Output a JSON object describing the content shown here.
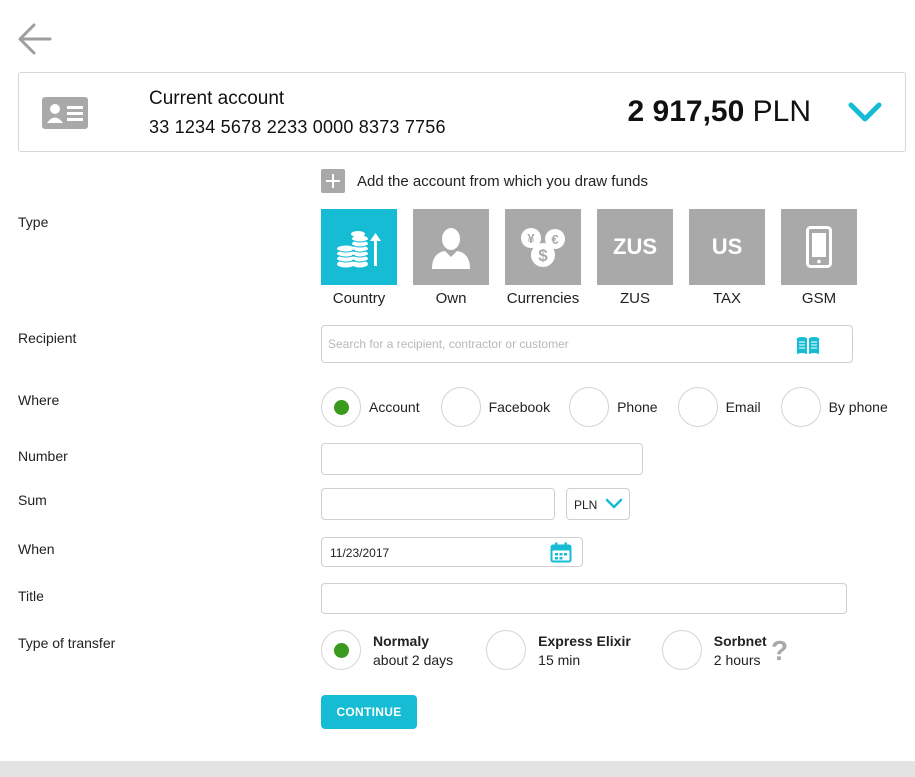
{
  "account": {
    "name": "Current account",
    "number": "33 1234 5678 2233 0000 8373 7756",
    "balance_amount": "2 917,50",
    "balance_currency": "PLN"
  },
  "add_account_label": "Add the account from which you draw funds",
  "labels": {
    "type": "Type",
    "recipient": "Recipient",
    "where": "Where",
    "number": "Number",
    "sum": "Sum",
    "when": "When",
    "title": "Title",
    "type_of_transfer": "Type of transfer"
  },
  "types": [
    {
      "label": "Country",
      "icon": "coins-growth-icon",
      "active": true
    },
    {
      "label": "Own",
      "icon": "person-icon",
      "active": false
    },
    {
      "label": "Currencies",
      "icon": "currency-exchange-icon",
      "active": false
    },
    {
      "label": "ZUS",
      "icon_text": "ZUS",
      "active": false
    },
    {
      "label": "TAX",
      "icon_text": "US",
      "active": false
    },
    {
      "label": "GSM",
      "icon": "mobile-phone-icon",
      "active": false
    }
  ],
  "recipient": {
    "placeholder": "Search for a recipient, contractor or customer",
    "value": ""
  },
  "where_options": [
    {
      "label": "Account",
      "checked": true
    },
    {
      "label": "Facebook",
      "checked": false
    },
    {
      "label": "Phone",
      "checked": false
    },
    {
      "label": "Email",
      "checked": false
    },
    {
      "label": "By phone",
      "checked": false
    }
  ],
  "number_value": "",
  "sum_value": "",
  "currency": "PLN",
  "date": "11/23/2017",
  "title_value": "",
  "transfer_types": [
    {
      "name": "Normaly",
      "desc": "about 2 days",
      "checked": true
    },
    {
      "name": "Express Elixir",
      "desc": "15 min",
      "checked": false
    },
    {
      "name": "Sorbnet",
      "desc": "2 hours",
      "checked": false
    }
  ],
  "help_glyph": "?",
  "continue_label": "CONTINUE",
  "colors": {
    "accent": "#16bcd3",
    "radio_checked": "#3a9a1e",
    "tile_inactive": "#a9a9a9"
  }
}
